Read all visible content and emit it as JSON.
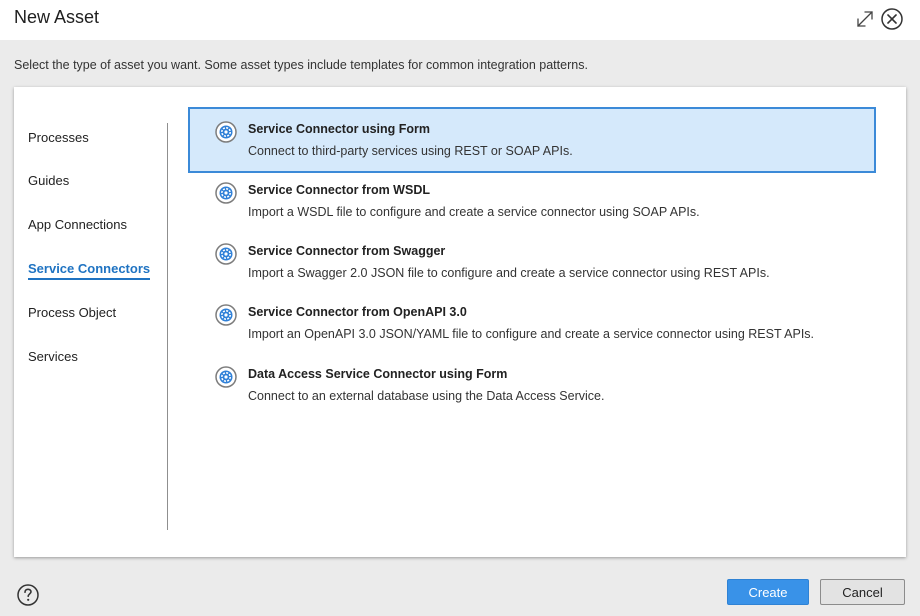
{
  "dialog": {
    "title": "New Asset",
    "instructions": "Select the type of asset you want. Some asset types include templates for common integration patterns."
  },
  "icons": {
    "expand": "expand-icon",
    "close": "close-circle-icon",
    "asset": "gear-icon",
    "help": "help-circle-icon"
  },
  "colors": {
    "accent": "#1f73c2",
    "selected_bg": "#d5e9fb",
    "selected_border": "#3b8ad8",
    "primary_button": "#3992e8"
  },
  "sidebar": {
    "items": [
      {
        "label": "Processes",
        "active": false
      },
      {
        "label": "Guides",
        "active": false
      },
      {
        "label": "App Connections",
        "active": false
      },
      {
        "label": "Service Connectors",
        "active": true
      },
      {
        "label": "Process Object",
        "active": false
      },
      {
        "label": "Services",
        "active": false
      }
    ]
  },
  "assets": {
    "items": [
      {
        "title": "Service Connector using Form",
        "description": "Connect to third-party services using REST or SOAP APIs.",
        "selected": true
      },
      {
        "title": "Service Connector from WSDL",
        "description": "Import a WSDL file to configure and create a service connector using SOAP APIs.",
        "selected": false
      },
      {
        "title": "Service Connector from Swagger",
        "description": "Import a Swagger 2.0 JSON file to configure and create a service connector using REST APIs.",
        "selected": false
      },
      {
        "title": "Service Connector from OpenAPI 3.0",
        "description": "Import an OpenAPI 3.0 JSON/YAML file to configure and create a service connector using REST APIs.",
        "selected": false
      },
      {
        "title": "Data Access Service Connector using Form",
        "description": "Connect to an external database using the Data Access Service.",
        "selected": false
      }
    ]
  },
  "footer": {
    "create_label": "Create",
    "cancel_label": "Cancel"
  }
}
